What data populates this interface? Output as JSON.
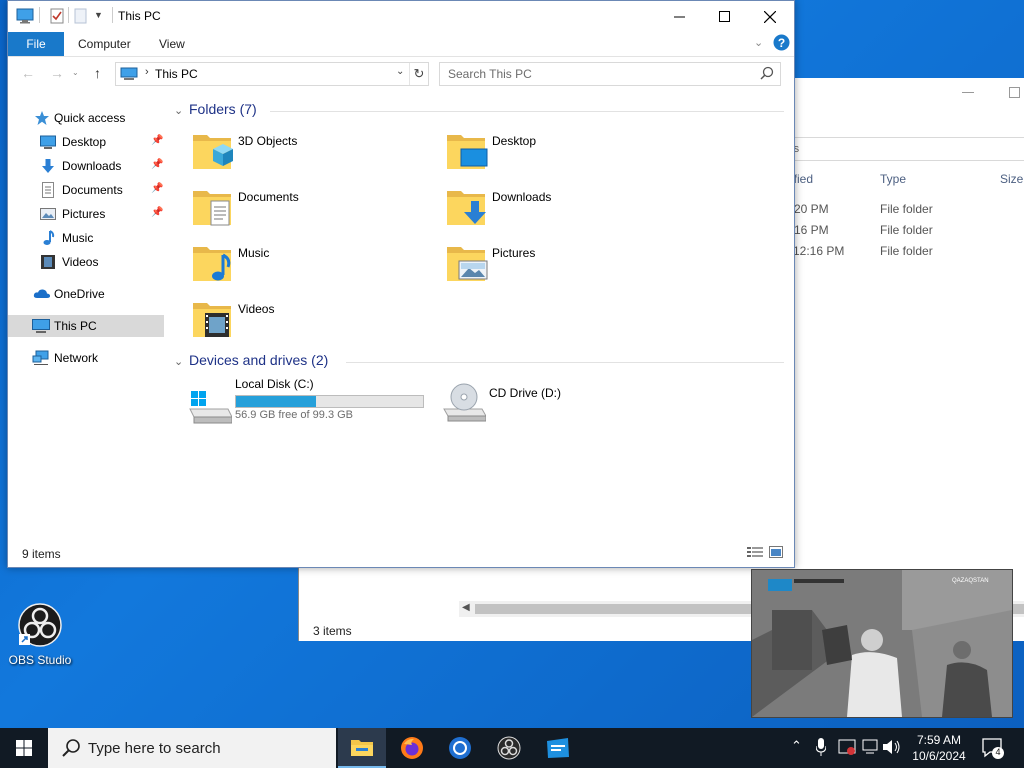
{
  "main_window": {
    "title": "This PC",
    "ribbon_tabs": {
      "file": "File",
      "computer": "Computer",
      "view": "View"
    },
    "address": "This PC",
    "search_placeholder": "Search This PC",
    "nav_pane": [
      {
        "label": "Quick access",
        "icon": "star-icon"
      },
      {
        "label": "Desktop",
        "icon": "desktop-icon",
        "pinned": true
      },
      {
        "label": "Downloads",
        "icon": "download-icon",
        "pinned": true
      },
      {
        "label": "Documents",
        "icon": "documents-icon",
        "pinned": true
      },
      {
        "label": "Pictures",
        "icon": "pictures-icon",
        "pinned": true
      },
      {
        "label": "Music",
        "icon": "music-icon"
      },
      {
        "label": "Videos",
        "icon": "videos-icon"
      },
      {
        "label": "OneDrive",
        "icon": "cloud-icon"
      },
      {
        "label": "This PC",
        "icon": "computer-icon",
        "selected": true
      },
      {
        "label": "Network",
        "icon": "network-icon"
      }
    ],
    "folders_header": "Folders (7)",
    "folders": [
      "3D Objects",
      "Desktop",
      "Documents",
      "Downloads",
      "Music",
      "Pictures",
      "Videos"
    ],
    "drives_header": "Devices and drives (2)",
    "drives": [
      {
        "name": "Local Disk (C:)",
        "free_text": "56.9 GB free of 99.3 GB",
        "used_fraction": 0.427
      },
      {
        "name": "CD Drive (D:)"
      }
    ],
    "status": "9 items"
  },
  "background_window": {
    "address_fragment": "rs",
    "col_modified": "ified",
    "col_type": "Type",
    "col_size": "Size",
    "rows": [
      {
        "modified": "20 PM",
        "type": "File folder"
      },
      {
        "modified": "16 PM",
        "type": "File folder"
      },
      {
        "modified": "12:16 PM",
        "type": "File folder"
      }
    ],
    "status": "3 items"
  },
  "desktop": {
    "obs_label": "OBS Studio"
  },
  "video": {
    "channel": "QAZAQSTAN"
  },
  "taskbar": {
    "search_placeholder": "Type here to search",
    "time": "7:59 AM",
    "date": "10/6/2024",
    "notification_count": "4"
  },
  "colors": {
    "accent": "#1979ca",
    "drive_bar": "#26a0da",
    "taskbar": "#111a24"
  }
}
